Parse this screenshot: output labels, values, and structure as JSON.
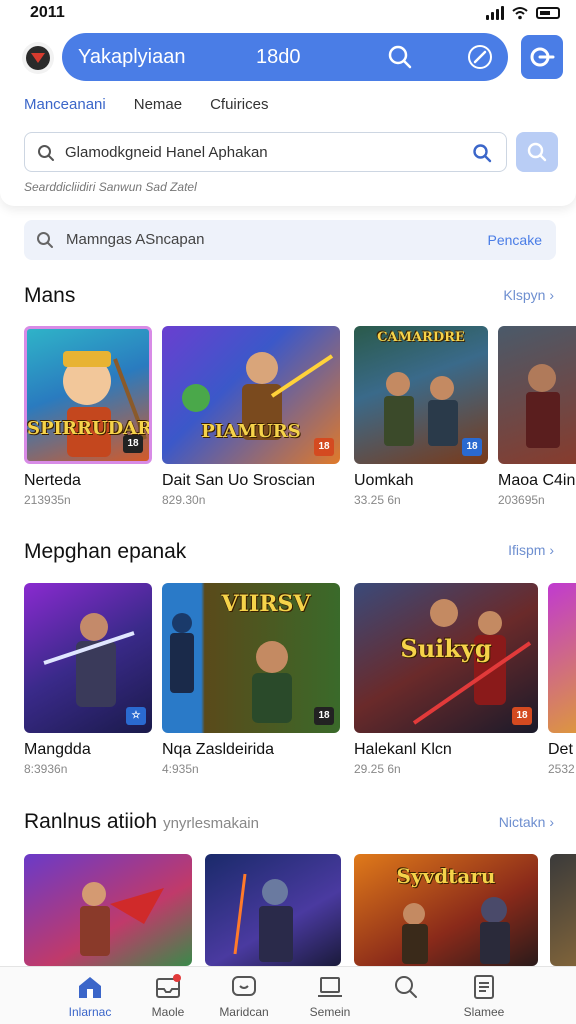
{
  "status_bar": {
    "time": "2011"
  },
  "header": {
    "title": "Yakaplyiaan",
    "number": "18d0",
    "tabs": [
      {
        "label": "Manceanani",
        "active": true
      },
      {
        "label": "Nemae",
        "active": false
      },
      {
        "label": "Cfuirices",
        "active": false
      }
    ],
    "search": {
      "placeholder": "Glamodkgneid Hanel Aphakan"
    },
    "hint": "Searddicliidiri Sanwun Sad Zatel"
  },
  "search2": {
    "placeholder": "Mamngas ASncapan",
    "action": "Pencake"
  },
  "sections": [
    {
      "title": "Mans",
      "subtitle": "",
      "link": "Klspyn",
      "items": [
        {
          "name": "Nerteda",
          "meta": "213935n",
          "art": "SPIRRUDAR"
        },
        {
          "name": "Dait San Uo Sroscian",
          "meta": "829.30n",
          "art": "PIAMURS"
        },
        {
          "name": "Uomkah",
          "meta": "33.25 6n",
          "art": "CAMARDRE"
        },
        {
          "name": "Maoa C4in",
          "meta": "203695n",
          "art": ""
        }
      ]
    },
    {
      "title": "Mepghan epanak",
      "subtitle": "",
      "link": "Ifispm",
      "items": [
        {
          "name": "Mangdda",
          "meta": "8:3936n",
          "art": ""
        },
        {
          "name": "Nqa Zasldeirida",
          "meta": "4:935n",
          "art": "VIIRSV"
        },
        {
          "name": "Halekanl Klcn",
          "meta": "29.25 6n",
          "art": "Suikyg"
        },
        {
          "name": "Det",
          "meta": "2532",
          "art": ""
        }
      ]
    },
    {
      "title": "Ranlnus atiioh",
      "subtitle": "ynyrlesmakain",
      "link": "Nictakn",
      "items": [
        {
          "name": "",
          "meta": "",
          "art": ""
        },
        {
          "name": "",
          "meta": "",
          "art": ""
        },
        {
          "name": "",
          "meta": "",
          "art": "Syvdtaru"
        },
        {
          "name": "",
          "meta": "",
          "art": ""
        }
      ]
    }
  ],
  "nav": [
    {
      "label": "Inlarnac",
      "icon": "home-icon",
      "active": true
    },
    {
      "label": "Maole",
      "icon": "inbox-icon",
      "active": false
    },
    {
      "label": "Maridcan",
      "icon": "chat-icon",
      "active": false
    },
    {
      "label": "Semein",
      "icon": "laptop-icon",
      "active": false
    },
    {
      "label": "",
      "icon": "search-icon",
      "active": false
    },
    {
      "label": "Slamee",
      "icon": "document-icon",
      "active": false
    }
  ],
  "colors": {
    "accent": "#4a7de6",
    "accent_text": "#3b66c9",
    "link": "#6e8fd0"
  }
}
